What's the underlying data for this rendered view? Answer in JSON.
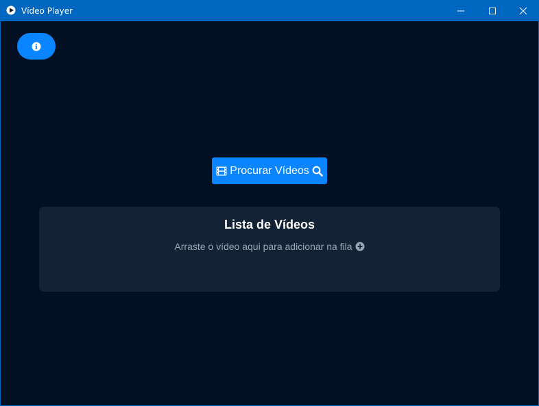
{
  "window": {
    "title": "Vídeo Player",
    "app_icon": "play-logo-icon",
    "controls": {
      "minimize_icon": "minimize-icon",
      "maximize_icon": "maximize-icon",
      "close_icon": "close-icon"
    },
    "accent_color": "#0067c0"
  },
  "toolbar": {
    "info_icon": "info-icon",
    "button_color": "#0a84ff"
  },
  "browse": {
    "label": "Procurar Vídeos",
    "leading_icon": "film-icon",
    "trailing_icon": "search-icon"
  },
  "video_list": {
    "title": "Lista de Vídeos",
    "hint": "Arraste o vídeo aqui para adicionar na fila",
    "hint_icon": "plus-circle-icon",
    "background_color": "#132335"
  },
  "theme": {
    "background": "#030f22"
  }
}
